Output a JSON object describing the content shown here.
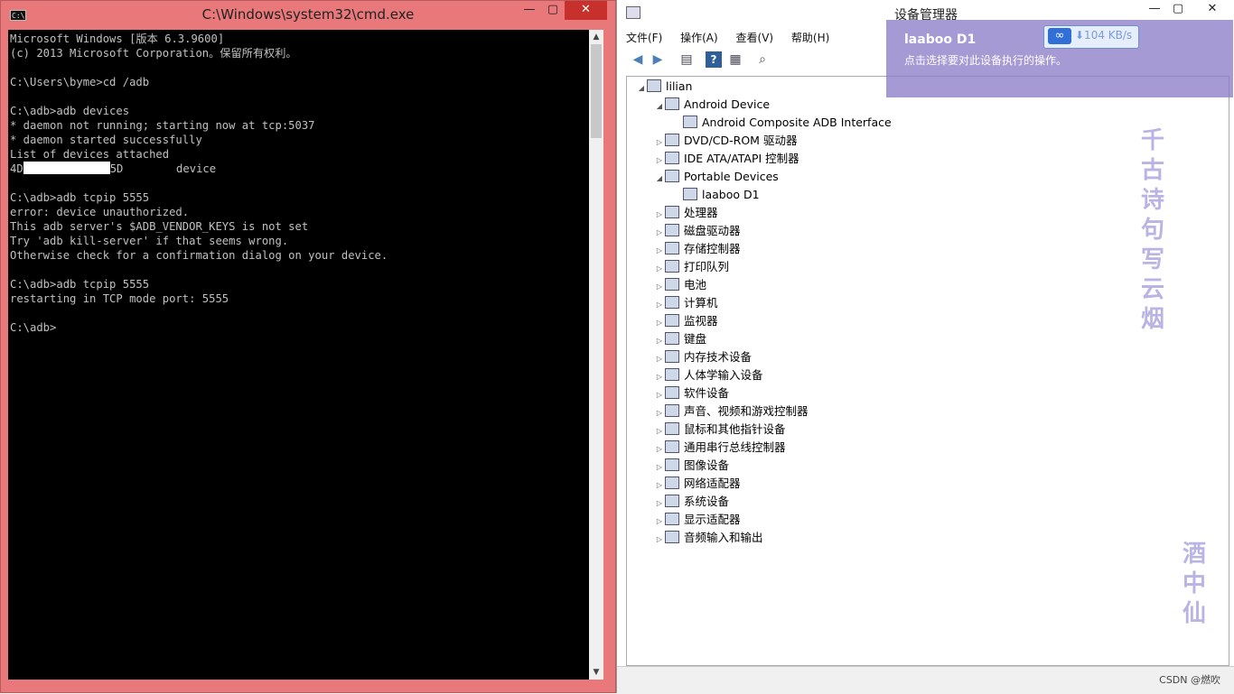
{
  "cmd": {
    "title": "C:\\Windows\\system32\\cmd.exe",
    "icon_text": "C:\\",
    "minimize": "—",
    "maximize": "▢",
    "close": "✕",
    "lines_before": "Microsoft Windows [版本 6.3.9600]\n(c) 2013 Microsoft Corporation。保留所有权利。\n\nC:\\Users\\byme>cd /adb\n\nC:\\adb>adb devices\n* daemon not running; starting now at tcp:5037\n* daemon started successfully\nList of devices attached",
    "device_prefix": "4D",
    "device_suffix": "5D        device",
    "lines_after": "\n\nC:\\adb>adb tcpip 5555\nerror: device unauthorized.\nThis adb server's $ADB_VENDOR_KEYS is not set\nTry 'adb kill-server' if that seems wrong.\nOtherwise check for a confirmation dialog on your device.\n\nC:\\adb>adb tcpip 5555\nrestarting in TCP mode port: 5555\n\nC:\\adb>"
  },
  "dm": {
    "title": "设备管理器",
    "menu": [
      "文件(F)",
      "操作(A)",
      "查看(V)",
      "帮助(H)"
    ],
    "toolbar_icons": [
      "back-arrow-icon",
      "forward-arrow-icon",
      "properties-icon",
      "help-icon",
      "view-icon",
      "scan-icon"
    ],
    "tree": [
      {
        "label": "lilian",
        "level": 0,
        "expander": "◢"
      },
      {
        "label": "Android Device",
        "level": 1,
        "expander": "◢"
      },
      {
        "label": "Android Composite ADB Interface",
        "level": 2,
        "expander": ""
      },
      {
        "label": "DVD/CD-ROM 驱动器",
        "level": 1,
        "expander": "▷"
      },
      {
        "label": "IDE ATA/ATAPI 控制器",
        "level": 1,
        "expander": "▷"
      },
      {
        "label": "Portable Devices",
        "level": 1,
        "expander": "◢"
      },
      {
        "label": "laaboo D1",
        "level": 2,
        "expander": ""
      },
      {
        "label": "处理器",
        "level": 1,
        "expander": "▷"
      },
      {
        "label": "磁盘驱动器",
        "level": 1,
        "expander": "▷"
      },
      {
        "label": "存储控制器",
        "level": 1,
        "expander": "▷"
      },
      {
        "label": "打印队列",
        "level": 1,
        "expander": "▷"
      },
      {
        "label": "电池",
        "level": 1,
        "expander": "▷"
      },
      {
        "label": "计算机",
        "level": 1,
        "expander": "▷"
      },
      {
        "label": "监视器",
        "level": 1,
        "expander": "▷"
      },
      {
        "label": "键盘",
        "level": 1,
        "expander": "▷"
      },
      {
        "label": "内存技术设备",
        "level": 1,
        "expander": "▷"
      },
      {
        "label": "人体学输入设备",
        "level": 1,
        "expander": "▷"
      },
      {
        "label": "软件设备",
        "level": 1,
        "expander": "▷"
      },
      {
        "label": "声音、视频和游戏控制器",
        "level": 1,
        "expander": "▷"
      },
      {
        "label": "鼠标和其他指针设备",
        "level": 1,
        "expander": "▷"
      },
      {
        "label": "通用串行总线控制器",
        "level": 1,
        "expander": "▷"
      },
      {
        "label": "图像设备",
        "level": 1,
        "expander": "▷"
      },
      {
        "label": "网络适配器",
        "level": 1,
        "expander": "▷"
      },
      {
        "label": "系统设备",
        "level": 1,
        "expander": "▷"
      },
      {
        "label": "显示适配器",
        "level": 1,
        "expander": "▷"
      },
      {
        "label": "音频输入和输出",
        "level": 1,
        "expander": "▷"
      }
    ],
    "watermark": "CSDN @燃吹"
  },
  "notification": {
    "title": "laaboo D1",
    "desc": "点击选择要对此设备执行的操作。"
  },
  "speed": {
    "icon": "∞",
    "text": "⬇104 KB/s"
  },
  "poem_top": [
    "千",
    "古",
    "诗",
    "句",
    "写",
    "云",
    "烟"
  ],
  "poem_bottom": [
    "酒",
    "中",
    "仙"
  ]
}
